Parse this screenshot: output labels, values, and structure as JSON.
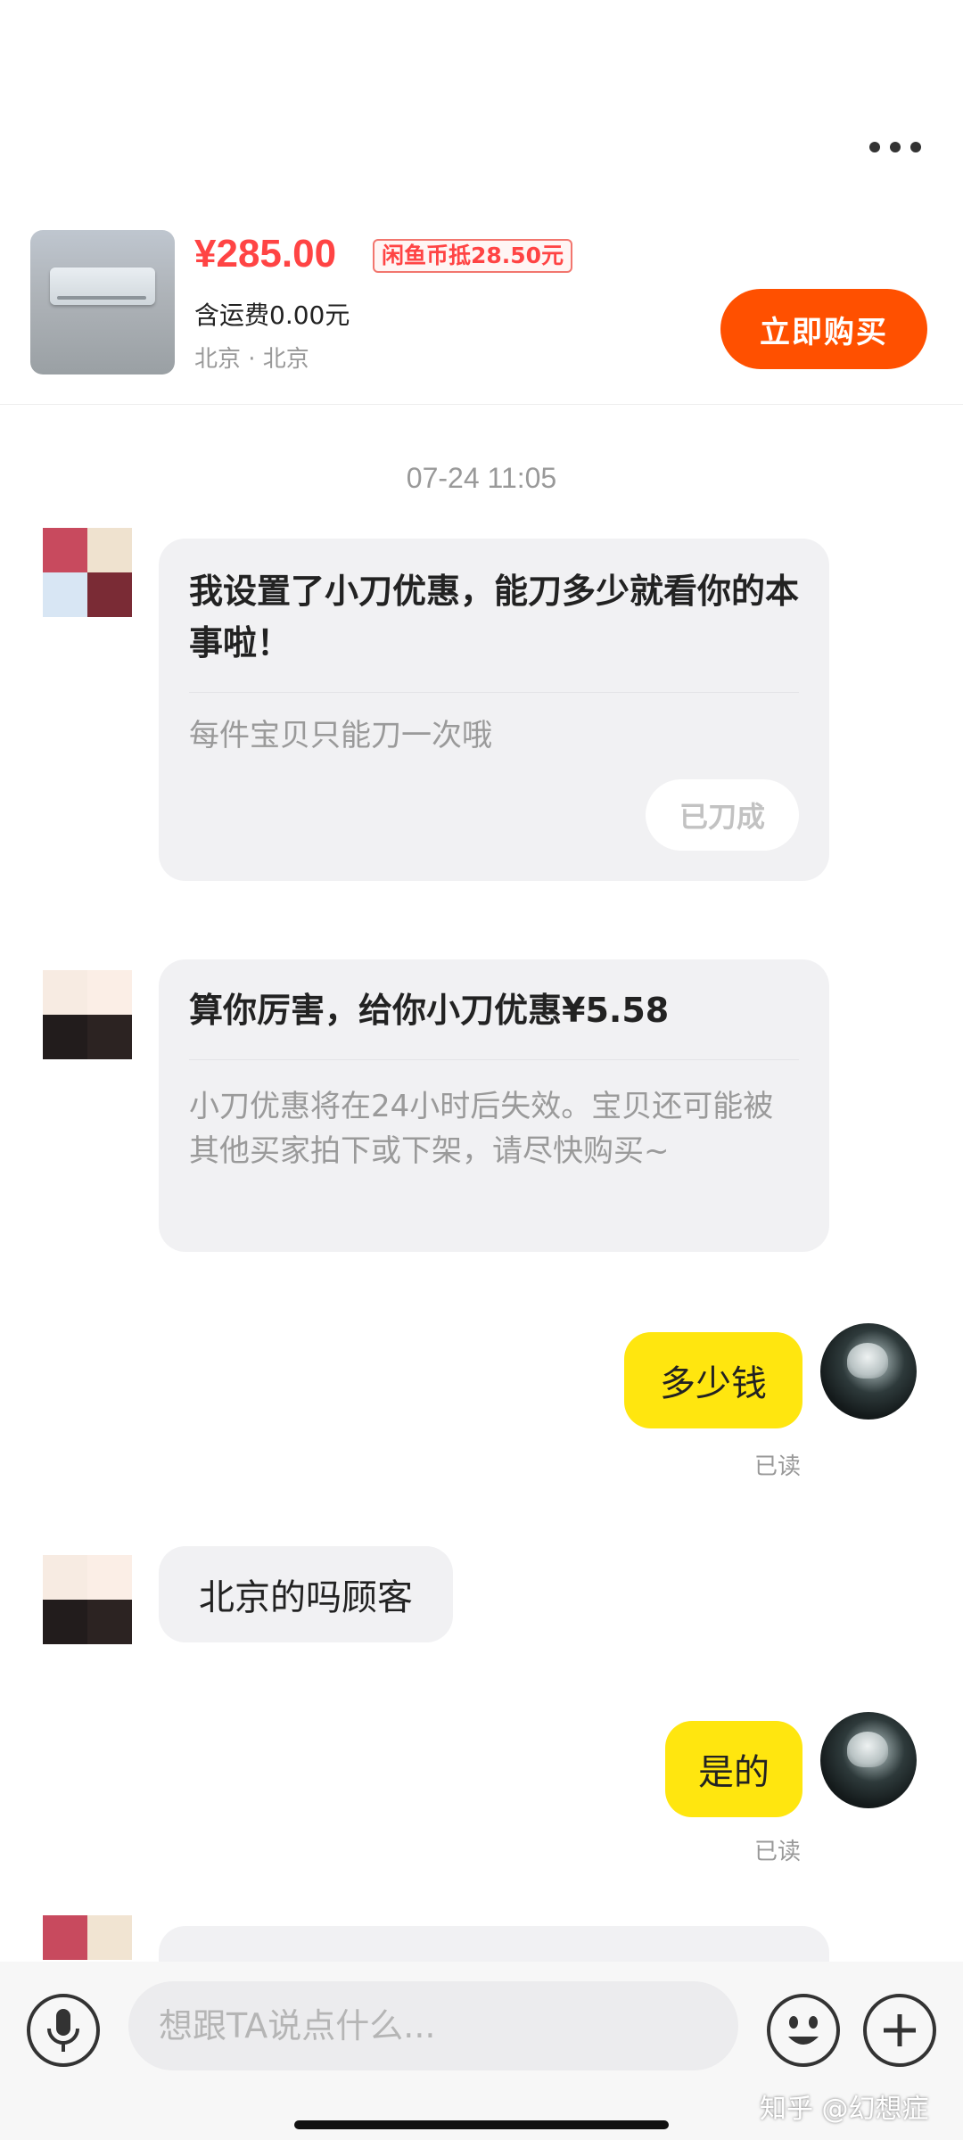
{
  "header": {
    "more_icon": "more-dots-icon"
  },
  "product": {
    "price": "¥285.00",
    "coin_discount": "闲鱼币抵28.50元",
    "shipping": "含运费0.00元",
    "location": "北京 · 北京",
    "buy_button": "立即购买"
  },
  "chat": {
    "timestamp": "07-24 11:05",
    "messages": [
      {
        "from": "seller",
        "type": "bargain-card",
        "title": "我设置了小刀优惠，能刀多少就看你的本事啦！",
        "subtitle": "每件宝贝只能刀一次哦",
        "action": "已刀成"
      },
      {
        "from": "seller",
        "type": "bargain-card",
        "title": "算你厉害，给你小刀优惠¥5.58",
        "subtitle": "小刀优惠将在24小时后失效。宝贝还可能被其他买家拍下或下架，请尽快购买~"
      },
      {
        "from": "me",
        "text": "多少钱",
        "status": "已读"
      },
      {
        "from": "seller",
        "text": "北京的吗顾客"
      },
      {
        "from": "me",
        "text": "是的",
        "status": "已读"
      }
    ]
  },
  "input_bar": {
    "placeholder": "想跟TA说点什么...",
    "mic_icon": "microphone-icon",
    "emoji_icon": "emoji-icon",
    "plus_icon": "plus-icon"
  },
  "watermark": "知乎 @幻想症",
  "colors": {
    "accent": "#ff5000",
    "price": "#ff4444",
    "my_bubble": "#ffe60f",
    "seller_bubble": "#f1f1f3"
  }
}
